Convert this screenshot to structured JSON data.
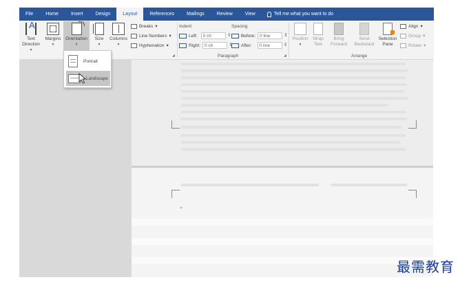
{
  "tabs": [
    {
      "label": "File"
    },
    {
      "label": "Home"
    },
    {
      "label": "Insert"
    },
    {
      "label": "Design"
    },
    {
      "label": "Layout",
      "active": true
    },
    {
      "label": "References"
    },
    {
      "label": "Mailings"
    },
    {
      "label": "Review"
    },
    {
      "label": "View"
    }
  ],
  "tell_me": "Tell me what you want to do",
  "page_setup": {
    "text_direction": "Text Direction",
    "margins": "Margins",
    "orientation": "Orientation",
    "size": "Size",
    "columns": "Columns",
    "breaks": "Breaks",
    "line_numbers": "Line Numbers",
    "hyphenation": "Hyphenation"
  },
  "paragraph": {
    "group_label": "Paragraph",
    "indent_label": "Indent",
    "spacing_label": "Spacing",
    "left_label": "Left:",
    "left_value": "0 ch",
    "right_label": "Right:",
    "right_value": "0 ch",
    "before_label": "Before:",
    "before_value": "0 line",
    "after_label": "After:",
    "after_value": "0 line"
  },
  "arrange": {
    "group_label": "Arrange",
    "position": "Position",
    "wrap_text": "Wrap Text",
    "bring_forward": "Bring Forward",
    "send_backward": "Send Backward",
    "selection_pane": "Selection Pane",
    "align": "Align",
    "group": "Group",
    "rotate": "Rotate"
  },
  "orientation_menu": {
    "portrait": "Portrait",
    "landscape": "Landscape",
    "hovered": "landscape"
  },
  "watermark": "最需教育",
  "colors": {
    "tabbar": "#2b579a",
    "ribbon": "#f3f3f3",
    "watermark": "#1b3d8f"
  }
}
